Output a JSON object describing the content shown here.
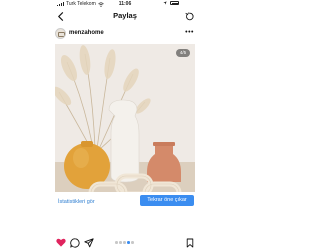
{
  "status_bar": {
    "carrier": "Turk Telekom",
    "time": "11:06"
  },
  "nav": {
    "title": "Paylaş",
    "back_icon": "chevron-left-icon",
    "right_icon": "refresh-icon"
  },
  "post": {
    "username": "menzahome",
    "more_label": "•••",
    "photo_counter": "4/5"
  },
  "buttons": {
    "insights_label": "İstatistikleri gör",
    "promote_label": "Tekrar öne çıkar"
  },
  "carousel": {
    "total": 5,
    "active_index": 3
  },
  "colors": {
    "link": "#2f7fd1",
    "primary": "#3b8df0",
    "like": "#e0245e"
  }
}
